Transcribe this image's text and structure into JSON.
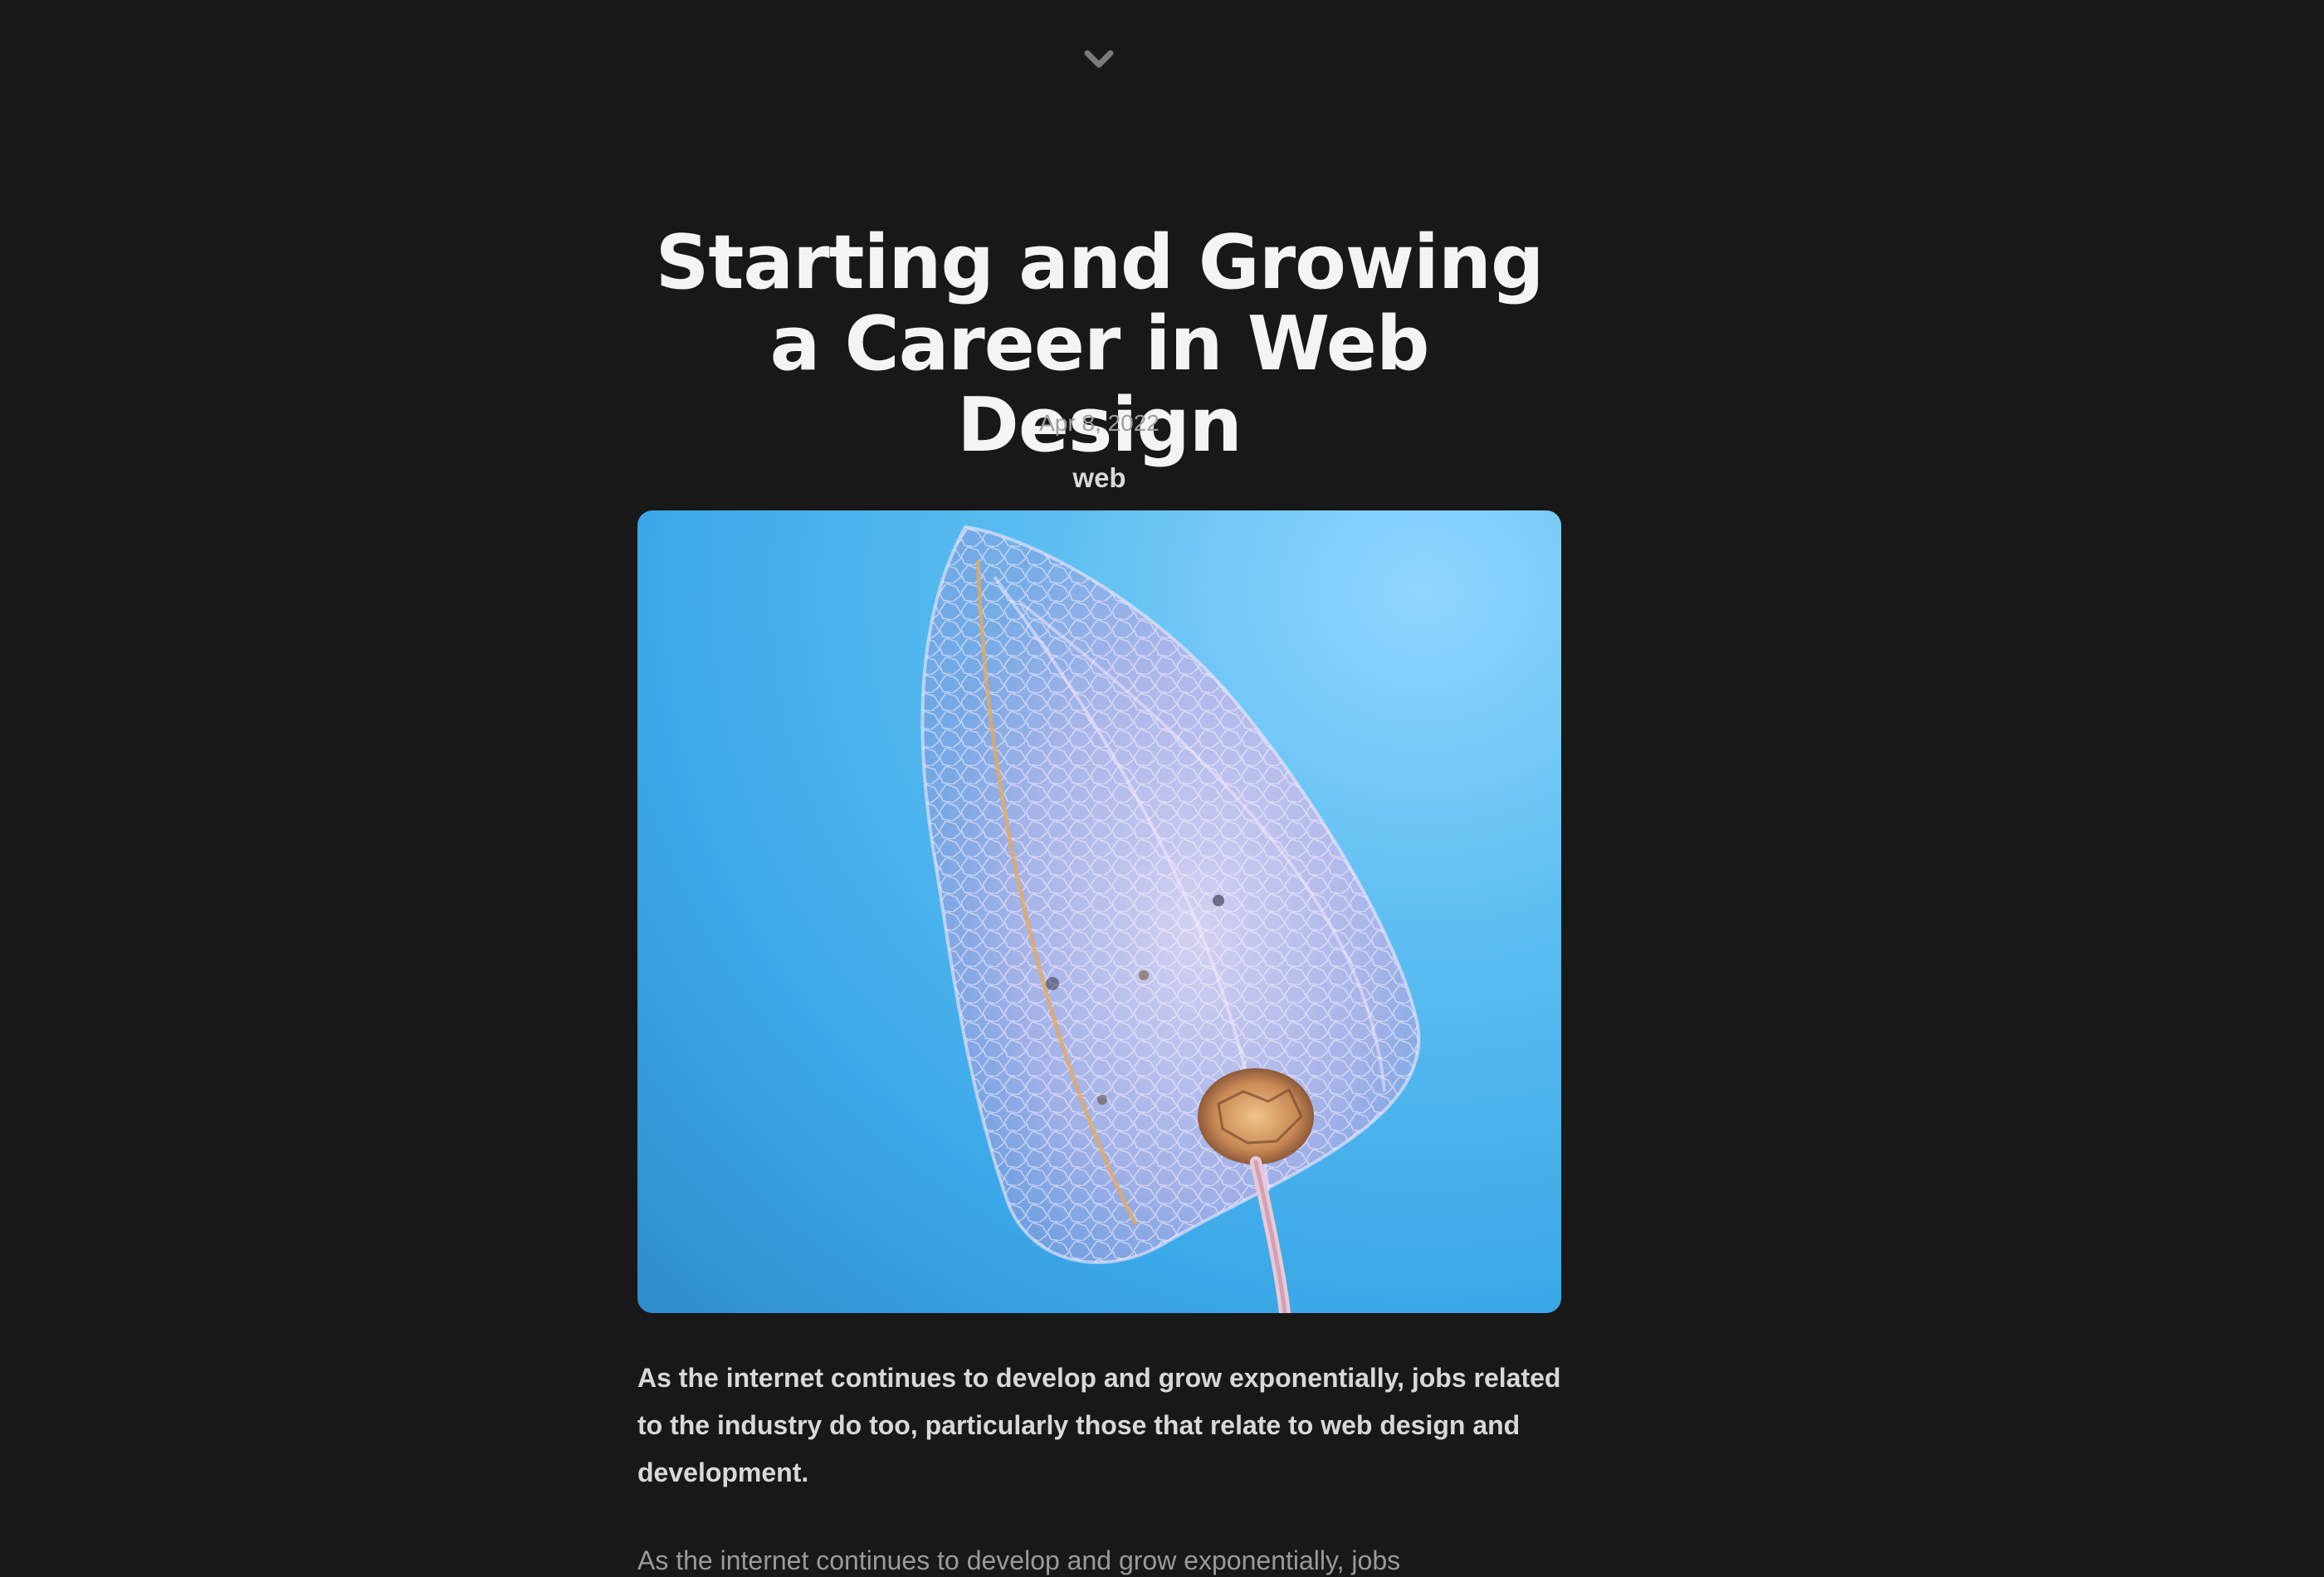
{
  "nav": {
    "collapse_icon": "chevron-down-icon"
  },
  "article": {
    "title": "Starting and Growing a Career in Web Design",
    "date": "Apr 8, 2022",
    "tag": "web",
    "hero_image": "physalis-leaf-skeleton-photo",
    "lead": "As the internet continues to develop and grow exponentially, jobs related to the industry do too, particularly those that relate to web design and development.",
    "body_start": "As the internet continues to develop and grow exponentially, jobs"
  },
  "colors": {
    "background": "#181818",
    "title": "#f4f4f4",
    "date": "#9e9e9e",
    "lead": "#d8d8d8",
    "body": "#9a9a9a",
    "image_sky": "#3aa8e8"
  }
}
